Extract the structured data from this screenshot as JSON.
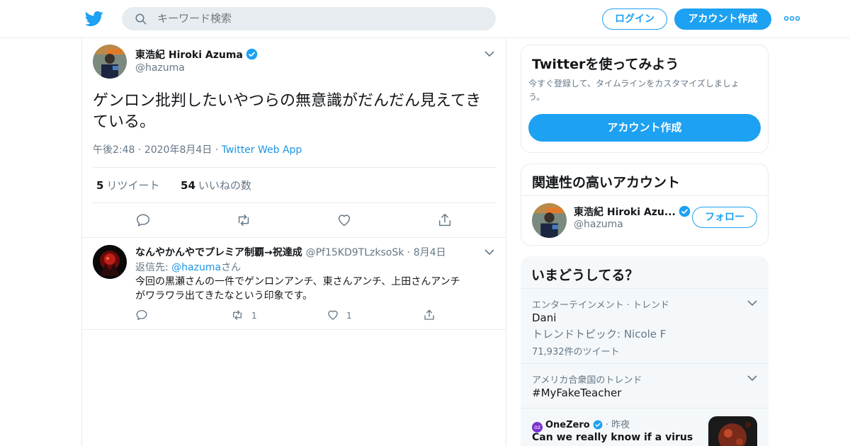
{
  "header": {
    "search_placeholder": "キーワード検索",
    "login_label": "ログイン",
    "signup_label": "アカウント作成"
  },
  "tweet": {
    "author_name": "東浩紀 Hiroki Azuma",
    "author_handle": "@hazuma",
    "text": "ゲンロン批判したいやつらの無意識がだんだん見えてきている。",
    "time": "午後2:48",
    "date": "2020年8月4日",
    "source": "Twitter Web App",
    "retweets_count": "5",
    "retweets_label": "リツイート",
    "likes_count": "54",
    "likes_label": "いいねの数"
  },
  "reply": {
    "author_name": "なんやかんやでプレミア制覇→祝達成",
    "author_handle": "@Pf15KD9TLzksoSk",
    "date": "8月4日",
    "reply_to_prefix": "返信先: ",
    "reply_to_handle": "@hazuma",
    "reply_to_suffix": "さん",
    "text_line1": "今回の黒瀬さんの一件でゲンロンアンチ、東さんアンチ、上田さんアンチ",
    "text_line2": "がワラワラ出てきたなという印象です。",
    "retweet_count": "1",
    "like_count": "1"
  },
  "sidebar": {
    "promo": {
      "title": "Twitterを使ってみよう",
      "subtitle_line1": "今すぐ登録して、タイムラインをカスタマイズしましょ",
      "subtitle_line2": "う。",
      "button_label": "アカウント作成"
    },
    "related": {
      "title": "関連性の高いアカウント",
      "name": "東浩紀 Hiroki Azu...",
      "handle": "@hazuma",
      "follow_label": "フォロー"
    },
    "trends": {
      "title": "いまどうしてる？",
      "items": [
        {
          "category": "エンターテインメント · トレンド",
          "name": "Dani",
          "subtitle": "トレンドトピック: Nicole F",
          "count": "71,932件のツイート"
        },
        {
          "category": "アメリカ合衆国のトレンド",
          "name": "#MyFakeTeacher"
        }
      ],
      "news": {
        "source": "OneZero",
        "time": "昨夜",
        "headline": "Can we really know if a virus was"
      }
    }
  },
  "colors": {
    "accent": "#1da1f2",
    "link": "#1b95e0",
    "text": "#14171a",
    "muted": "#657786",
    "border": "#e6ecf0"
  }
}
